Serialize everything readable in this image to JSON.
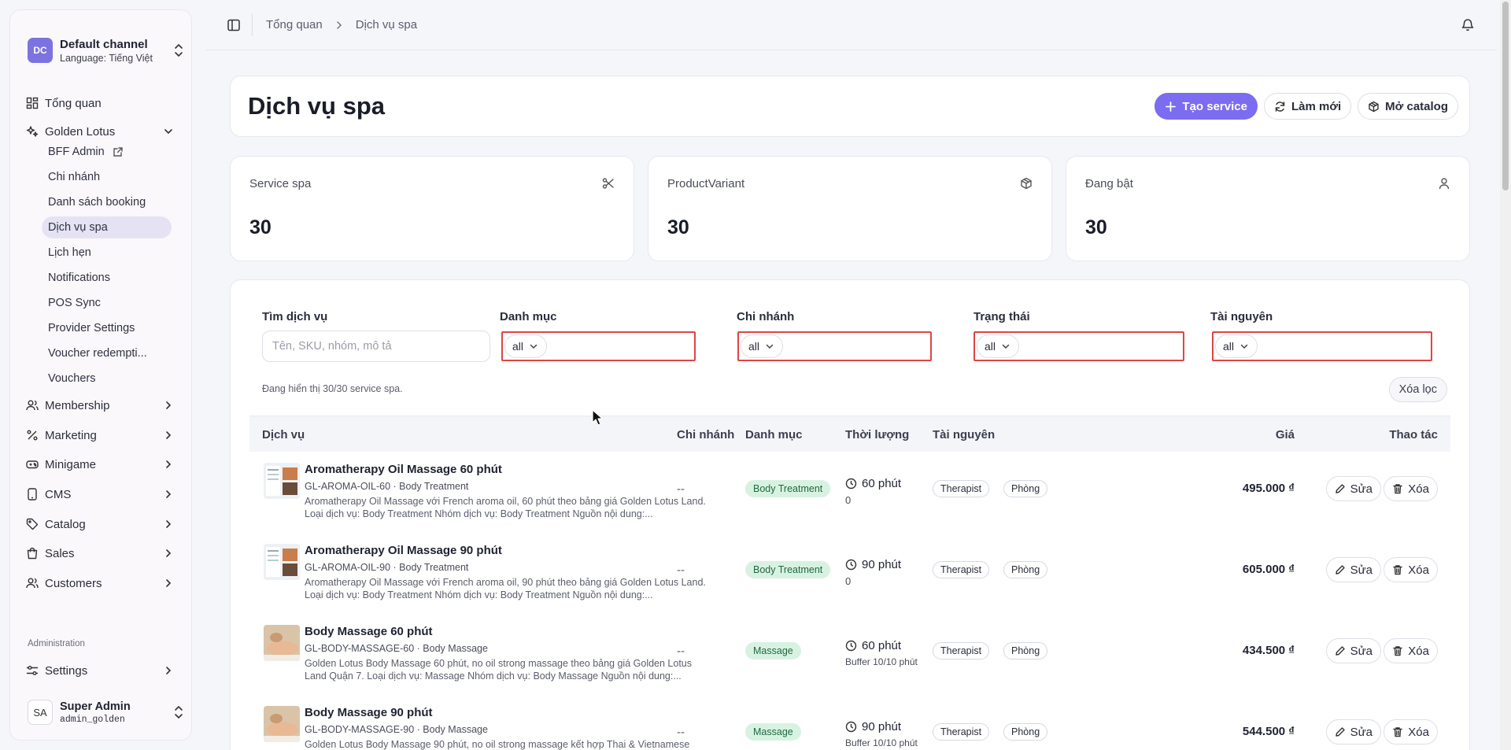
{
  "channel": {
    "initials": "DC",
    "name": "Default channel",
    "language": "Language: Tiếng Việt"
  },
  "sidebar": {
    "overview": "Tổng quan",
    "group": "Golden Lotus",
    "sub_items": [
      {
        "label": "BFF Admin",
        "external": true
      },
      {
        "label": "Chi nhánh"
      },
      {
        "label": "Danh sách booking"
      },
      {
        "label": "Dịch vụ spa",
        "active": true
      },
      {
        "label": "Lịch hẹn"
      },
      {
        "label": "Notifications"
      },
      {
        "label": "POS Sync"
      },
      {
        "label": "Provider Settings"
      },
      {
        "label": "Voucher redempti..."
      },
      {
        "label": "Vouchers"
      }
    ],
    "sections": [
      {
        "label": "Membership",
        "icon": "users-icon"
      },
      {
        "label": "Marketing",
        "icon": "percent-icon"
      },
      {
        "label": "Minigame",
        "icon": "gamepad-icon"
      },
      {
        "label": "CMS",
        "icon": "tablet-icon"
      },
      {
        "label": "Catalog",
        "icon": "tag-icon"
      },
      {
        "label": "Sales",
        "icon": "shopping-bag-icon"
      },
      {
        "label": "Customers",
        "icon": "users-icon"
      }
    ],
    "admin_heading": "Administration",
    "settings": "Settings"
  },
  "user": {
    "initials": "SA",
    "name": "Super Admin",
    "handle": "admin_golden"
  },
  "breadcrumb": {
    "root": "Tổng quan",
    "current": "Dịch vụ spa"
  },
  "page": {
    "title": "Dịch vụ spa",
    "create_label": "Tạo service",
    "refresh_label": "Làm mới",
    "catalog_label": "Mở catalog"
  },
  "stats": [
    {
      "label": "Service spa",
      "value": "30",
      "icon": "scissors-icon"
    },
    {
      "label": "ProductVariant",
      "value": "30",
      "icon": "package-icon"
    },
    {
      "label": "Đang bật",
      "value": "30",
      "icon": "user-icon"
    }
  ],
  "filters": {
    "search_label": "Tìm dịch vụ",
    "search_placeholder": "Tên, SKU, nhóm, mô tả",
    "category_label": "Danh mục",
    "category_value": "all",
    "branch_label": "Chi nhánh",
    "branch_value": "all",
    "status_label": "Trạng thái",
    "status_value": "all",
    "resource_label": "Tài nguyên",
    "resource_value": "all",
    "count_text": "Đang hiển thị 30/30 service spa.",
    "clear_label": "Xóa lọc"
  },
  "table": {
    "headers": {
      "service": "Dịch vụ",
      "branch": "Chi nhánh",
      "category": "Danh mục",
      "duration": "Thời lượng",
      "resource": "Tài nguyên",
      "price": "Giá",
      "actions": "Thao tác"
    },
    "edit_label": "Sửa",
    "delete_label": "Xóa",
    "rows": [
      {
        "name": "Aromatherapy Oil Massage 60 phút",
        "sku": "GL-AROMA-OIL-60 · Body Treatment",
        "desc": "Aromatherapy Oil Massage với French aroma oil, 60 phút theo bảng giá Golden Lotus Land. Loại dịch vụ: Body Treatment Nhóm dịch vụ: Body Treatment Nguồn nội dung:...",
        "branch": "--",
        "category": "Body Treatment",
        "duration": "60 phút",
        "duration_sub": "0",
        "resources": [
          "Therapist",
          "Phòng"
        ],
        "price": "495.000 ₫"
      },
      {
        "name": "Aromatherapy Oil Massage 90 phút",
        "sku": "GL-AROMA-OIL-90 · Body Treatment",
        "desc": "Aromatherapy Oil Massage với French aroma oil, 90 phút theo bảng giá Golden Lotus Land. Loại dịch vụ: Body Treatment Nhóm dịch vụ: Body Treatment Nguồn nội dung:...",
        "branch": "--",
        "category": "Body Treatment",
        "duration": "90 phút",
        "duration_sub": "0",
        "resources": [
          "Therapist",
          "Phòng"
        ],
        "price": "605.000 ₫"
      },
      {
        "name": "Body Massage 60 phút",
        "sku": "GL-BODY-MASSAGE-60 · Body Massage",
        "desc": "Golden Lotus Body Massage 60 phút, no oil strong massage theo bảng giá Golden Lotus Land Quận 7. Loại dịch vụ: Massage Nhóm dịch vụ: Body Massage Nguồn nội dung:...",
        "branch": "--",
        "category": "Massage",
        "duration": "60 phút",
        "duration_sub": "Buffer 10/10 phút",
        "resources": [
          "Therapist",
          "Phòng"
        ],
        "price": "434.500 ₫"
      },
      {
        "name": "Body Massage 90 phút",
        "sku": "GL-BODY-MASSAGE-90 · Body Massage",
        "desc": "Golden Lotus Body Massage 90 phút, no oil strong massage kết hợp Thai & Vietnamese",
        "branch": "--",
        "category": "Massage",
        "duration": "90 phút",
        "duration_sub": "Buffer 10/10 phút",
        "resources": [
          "Therapist",
          "Phòng"
        ],
        "price": "544.500 ₫"
      }
    ]
  }
}
